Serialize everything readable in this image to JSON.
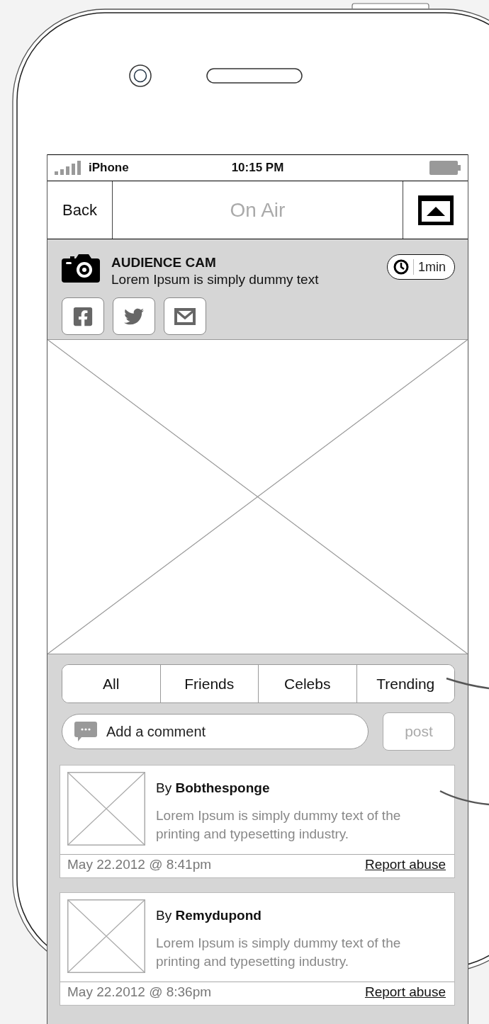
{
  "status_bar": {
    "carrier": "iPhone",
    "time": "10:15 PM"
  },
  "nav_bar": {
    "back": "Back",
    "title": "On Air"
  },
  "header": {
    "title": "AUDIENCE CAM",
    "subtitle": "Lorem Ipsum is simply dummy text",
    "timer": "1min"
  },
  "filter_tabs": [
    {
      "label": "All"
    },
    {
      "label": "Friends"
    },
    {
      "label": "Celebs"
    },
    {
      "label": "Trending"
    }
  ],
  "comment_box": {
    "placeholder": "Add a comment",
    "button": "post"
  },
  "comments": [
    {
      "author": "By **Bobthesponge**",
      "text": "Lorem Ipsum is simply dummy text of the printing and typesetting industry.",
      "date": "May 22.2012 @ 8:41pm",
      "action": "Report abuse"
    },
    {
      "author": "By **Remydupond**",
      "text": "Lorem Ipsum is simply dummy text of the printing and typesetting industry.",
      "date": "May 22.2012 @ 8:36pm",
      "action": "Report abuse"
    }
  ]
}
